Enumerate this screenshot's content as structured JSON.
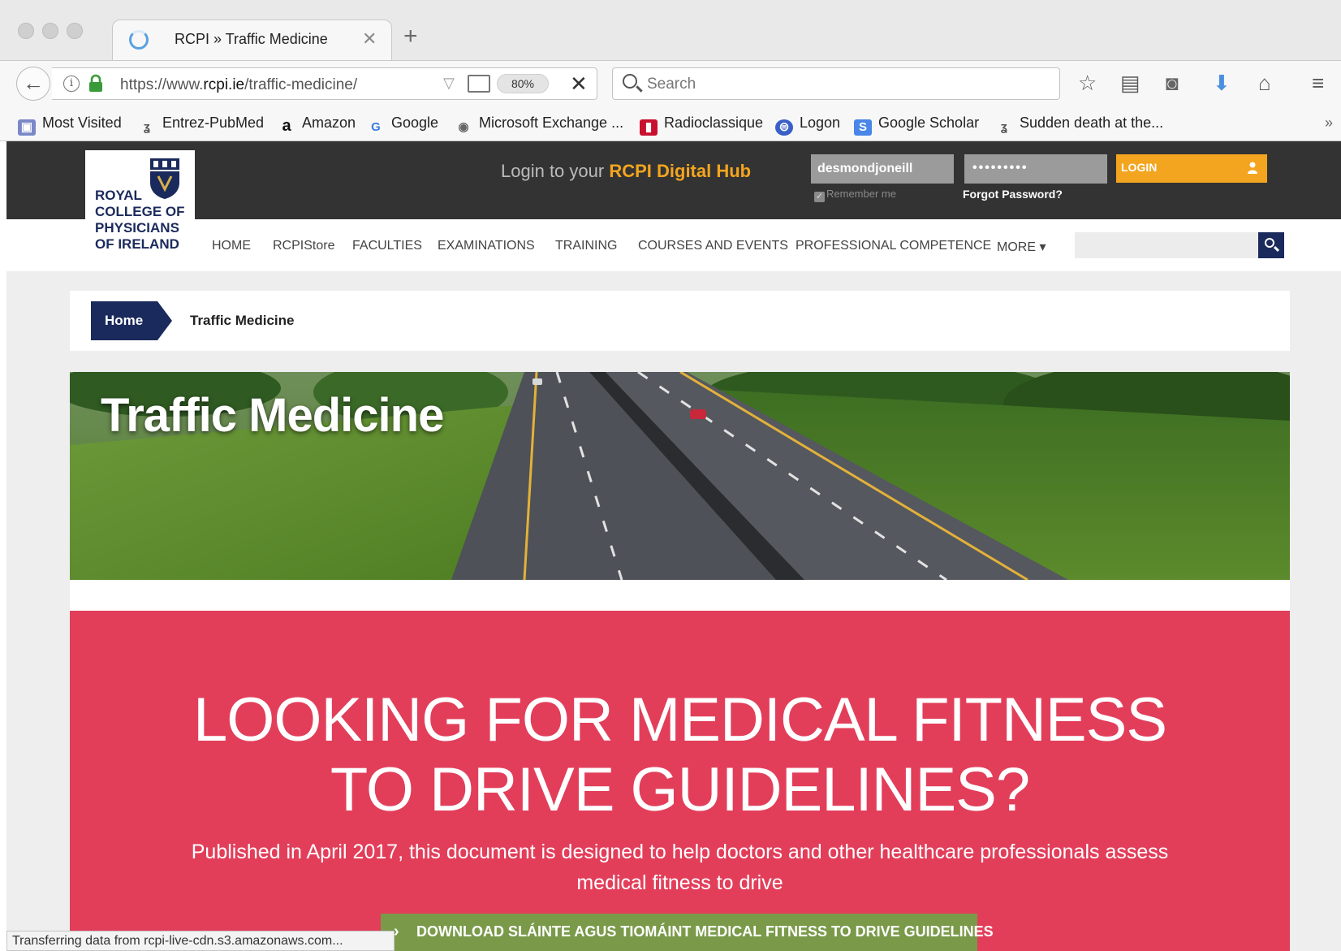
{
  "browser": {
    "tab_title": "RCPI » Traffic Medicine",
    "url_prefix": "https://www.",
    "url_domain": "rcpi.ie",
    "url_path": "/traffic-medicine/",
    "zoom": "80%",
    "search_placeholder": "Search",
    "bookmarks": [
      {
        "label": "Most Visited",
        "icon": "folder-icon"
      },
      {
        "label": "Entrez-PubMed",
        "icon": "dna-icon"
      },
      {
        "label": "Amazon",
        "icon": "amazon-icon"
      },
      {
        "label": "Google",
        "icon": "google-icon"
      },
      {
        "label": "Microsoft Exchange ...",
        "icon": "globe-icon"
      },
      {
        "label": "Radioclassique",
        "icon": "radio-icon"
      },
      {
        "label": "Logon",
        "icon": "lock-icon"
      },
      {
        "label": "Google Scholar",
        "icon": "scholar-icon"
      },
      {
        "label": "Sudden death at the...",
        "icon": "dna-icon"
      }
    ],
    "overflow": "»",
    "status_text": "Transferring data from rcpi-live-cdn.s3.amazonaws.com..."
  },
  "site": {
    "logo_lines": [
      "ROYAL",
      "COLLEGE OF",
      "PHYSICIANS",
      "OF IRELAND"
    ],
    "login_prompt": "Login to your",
    "login_hub": "RCPI Digital Hub",
    "username_value": "desmondjoneill",
    "password_mask": "•••••••••",
    "remember_label": "Remember me",
    "forgot_label": "Forgot Password?",
    "login_label": "LOGIN",
    "nav": [
      "HOME",
      "RCPIStore",
      "FACULTIES",
      "EXAMINATIONS",
      "TRAINING",
      "COURSES AND EVENTS",
      "PROFESSIONAL COMPETENCE",
      "MORE ▾"
    ],
    "breadcrumb_home": "Home",
    "breadcrumb_current": "Traffic Medicine",
    "hero_title": "Traffic Medicine",
    "promo_heading_line1": "LOOKING FOR MEDICAL FITNESS",
    "promo_heading_line2": "TO DRIVE GUIDELINES?",
    "promo_sub": "Published in April 2017, this document is designed to help doctors and other healthcare professionals assess medical fitness to drive",
    "download_label": "DOWNLOAD SLÁINTE AGUS TIOMÁINT MEDICAL FITNESS TO DRIVE GUIDELINES"
  },
  "colors": {
    "navy": "#1b2a5c",
    "orange": "#f3a51f",
    "promo_red": "#e23e5a",
    "download_green": "#7a9a4a",
    "topbar": "#333333"
  }
}
